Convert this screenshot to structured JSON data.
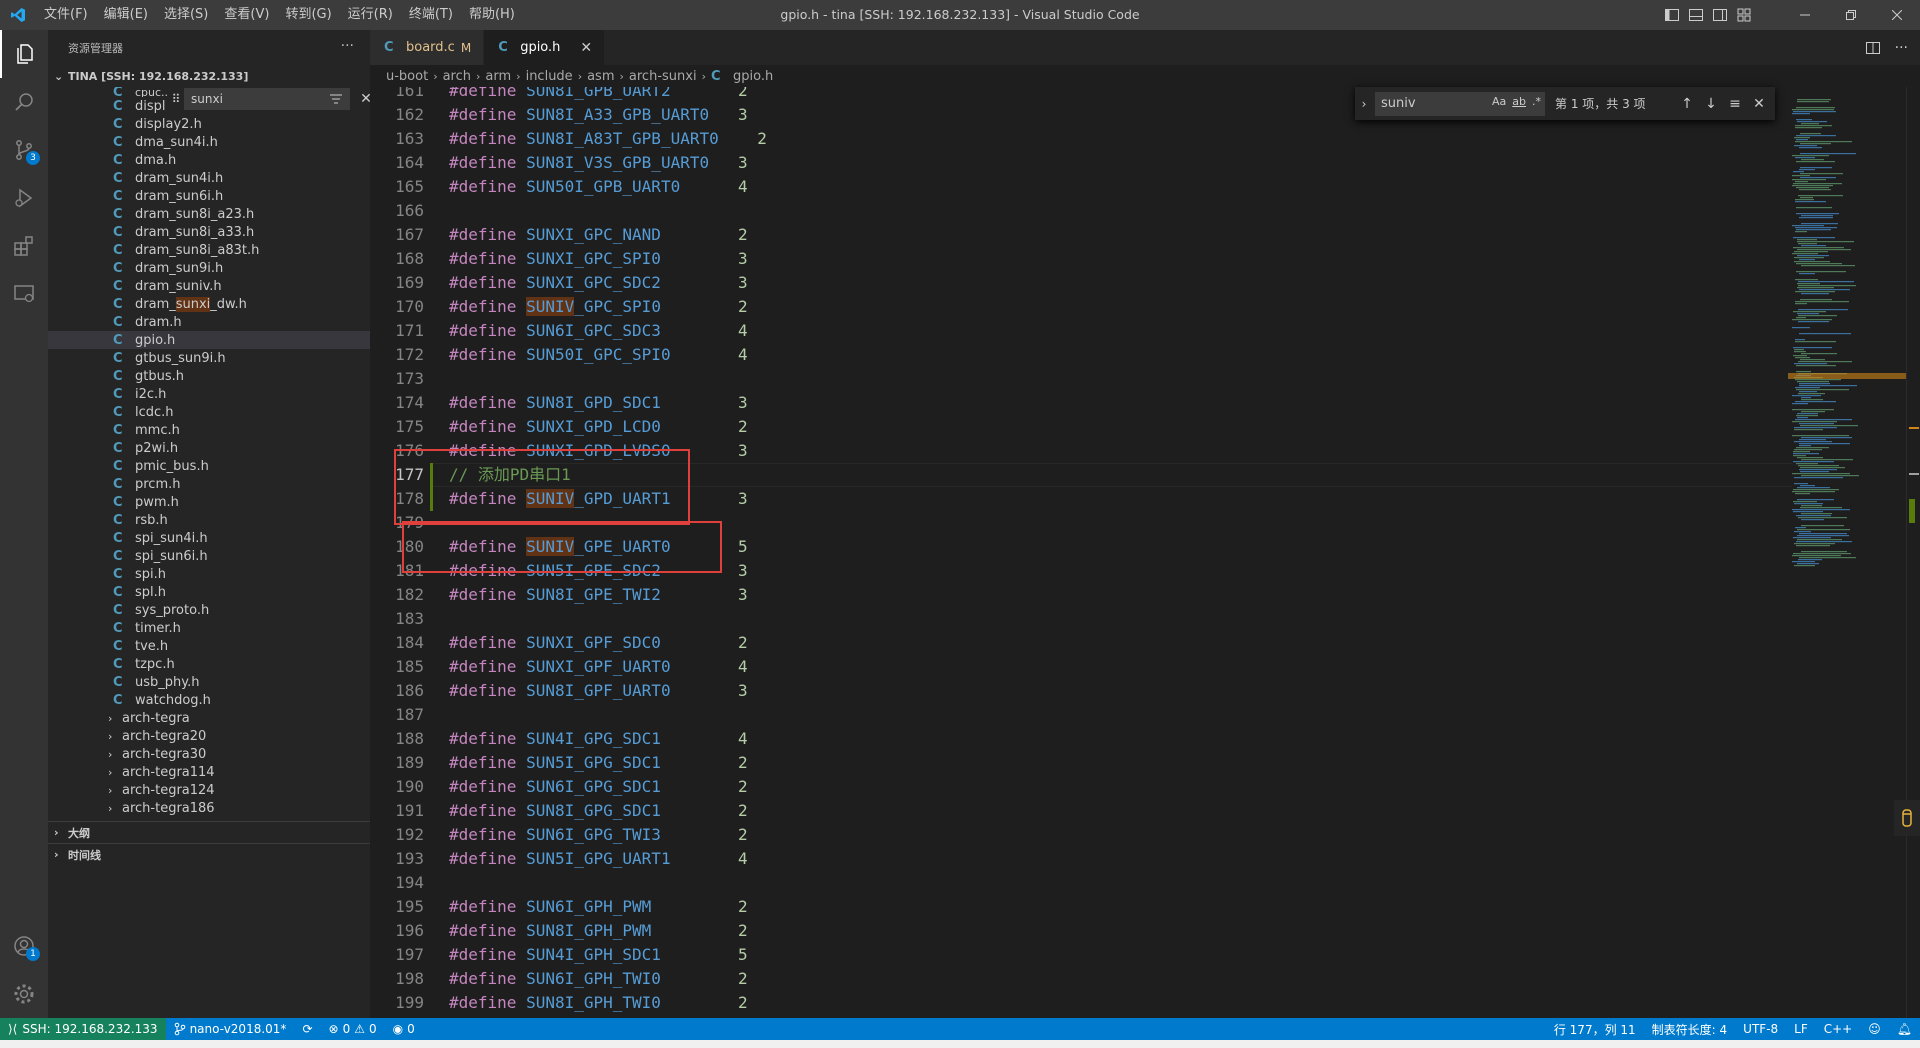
{
  "window": {
    "title": "gpio.h - tina [SSH: 192.168.232.133] - Visual Studio Code",
    "menu": [
      "文件(F)",
      "编辑(E)",
      "选择(S)",
      "查看(V)",
      "转到(G)",
      "运行(R)",
      "终端(T)",
      "帮助(H)"
    ]
  },
  "activity_bar": {
    "source_control_badge": "3",
    "accounts_badge": "1"
  },
  "sidebar": {
    "header": "资源管理器",
    "more": "···",
    "root": "TINA [SSH: 192.168.232.133]",
    "filter_value": "sunxi",
    "partial_top": "cpuc...",
    "files": [
      {
        "pre": "displ",
        "mid": "",
        "post": ""
      },
      {
        "pre": "display2.h",
        "mid": "",
        "post": ""
      },
      {
        "pre": "dma_sun4i.h",
        "mid": "",
        "post": ""
      },
      {
        "pre": "dma.h",
        "mid": "",
        "post": ""
      },
      {
        "pre": "dram_sun4i.h",
        "mid": "",
        "post": ""
      },
      {
        "pre": "dram_sun6i.h",
        "mid": "",
        "post": ""
      },
      {
        "pre": "dram_sun8i_a23.h",
        "mid": "",
        "post": ""
      },
      {
        "pre": "dram_sun8i_a33.h",
        "mid": "",
        "post": ""
      },
      {
        "pre": "dram_sun8i_a83t.h",
        "mid": "",
        "post": ""
      },
      {
        "pre": "dram_sun9i.h",
        "mid": "",
        "post": ""
      },
      {
        "pre": "dram_suniv.h",
        "mid": "",
        "post": ""
      },
      {
        "pre": "dram_",
        "mid": "sunxi",
        "post": "_dw.h"
      },
      {
        "pre": "dram.h",
        "mid": "",
        "post": ""
      },
      {
        "pre": "gpio.h",
        "mid": "",
        "post": ""
      },
      {
        "pre": "gtbus_sun9i.h",
        "mid": "",
        "post": ""
      },
      {
        "pre": "gtbus.h",
        "mid": "",
        "post": ""
      },
      {
        "pre": "i2c.h",
        "mid": "",
        "post": ""
      },
      {
        "pre": "lcdc.h",
        "mid": "",
        "post": ""
      },
      {
        "pre": "mmc.h",
        "mid": "",
        "post": ""
      },
      {
        "pre": "p2wi.h",
        "mid": "",
        "post": ""
      },
      {
        "pre": "pmic_bus.h",
        "mid": "",
        "post": ""
      },
      {
        "pre": "prcm.h",
        "mid": "",
        "post": ""
      },
      {
        "pre": "pwm.h",
        "mid": "",
        "post": ""
      },
      {
        "pre": "rsb.h",
        "mid": "",
        "post": ""
      },
      {
        "pre": "spi_sun4i.h",
        "mid": "",
        "post": ""
      },
      {
        "pre": "spi_sun6i.h",
        "mid": "",
        "post": ""
      },
      {
        "pre": "spi.h",
        "mid": "",
        "post": ""
      },
      {
        "pre": "spl.h",
        "mid": "",
        "post": ""
      },
      {
        "pre": "sys_proto.h",
        "mid": "",
        "post": ""
      },
      {
        "pre": "timer.h",
        "mid": "",
        "post": ""
      },
      {
        "pre": "tve.h",
        "mid": "",
        "post": ""
      },
      {
        "pre": "tzpc.h",
        "mid": "",
        "post": ""
      },
      {
        "pre": "usb_phy.h",
        "mid": "",
        "post": ""
      },
      {
        "pre": "watchdog.h",
        "mid": "",
        "post": ""
      }
    ],
    "folders": [
      "arch-tegra",
      "arch-tegra20",
      "arch-tegra30",
      "arch-tegra114",
      "arch-tegra124",
      "arch-tegra186"
    ],
    "outline": "大纲",
    "timeline": "时间线"
  },
  "tabs": [
    {
      "label": "board.c",
      "modified": "M",
      "active": false
    },
    {
      "label": "gpio.h",
      "modified": "",
      "active": true
    }
  ],
  "breadcrumbs": [
    "u-boot",
    "arch",
    "arm",
    "include",
    "asm",
    "arch-sunxi",
    "gpio.h"
  ],
  "find_widget": {
    "value": "suniv",
    "opt_case": "Aa",
    "opt_word": "ab",
    "opt_regex": ".*",
    "count": "第 1 项，共 3 项"
  },
  "code": [
    {
      "n": "161",
      "kw": "#define",
      "pre": "SUN8I_GPB_UART2",
      "hl": "",
      "post": "",
      "pad": "       ",
      "num": "2"
    },
    {
      "n": "162",
      "kw": "#define",
      "pre": "SUN8I_A33_GPB_UART0",
      "hl": "",
      "post": "",
      "pad": "   ",
      "num": "3"
    },
    {
      "n": "163",
      "kw": "#define",
      "pre": "SUN8I_A83T_GPB_UART0",
      "hl": "",
      "post": "",
      "pad": "    ",
      "num": "2"
    },
    {
      "n": "164",
      "kw": "#define",
      "pre": "SUN8I_V3S_GPB_UART0",
      "hl": "",
      "post": "",
      "pad": "   ",
      "num": "3"
    },
    {
      "n": "165",
      "kw": "#define",
      "pre": "SUN50I_GPB_UART0",
      "hl": "",
      "post": "",
      "pad": "      ",
      "num": "4"
    },
    {
      "n": "166",
      "kw": "",
      "pre": "",
      "hl": "",
      "post": "",
      "pad": "",
      "num": ""
    },
    {
      "n": "167",
      "kw": "#define",
      "pre": "SUNXI_GPC_NAND",
      "hl": "",
      "post": "",
      "pad": "        ",
      "num": "2"
    },
    {
      "n": "168",
      "kw": "#define",
      "pre": "SUNXI_GPC_SPI0",
      "hl": "",
      "post": "",
      "pad": "        ",
      "num": "3"
    },
    {
      "n": "169",
      "kw": "#define",
      "pre": "SUNXI_GPC_SDC2",
      "hl": "",
      "post": "",
      "pad": "        ",
      "num": "3"
    },
    {
      "n": "170",
      "kw": "#define",
      "pre": "",
      "hl": "SUNIV",
      "post": "_GPC_SPI0",
      "pad": "        ",
      "num": "2"
    },
    {
      "n": "171",
      "kw": "#define",
      "pre": "SUN6I_GPC_SDC3",
      "hl": "",
      "post": "",
      "pad": "        ",
      "num": "4"
    },
    {
      "n": "172",
      "kw": "#define",
      "pre": "SUN50I_GPC_SPI0",
      "hl": "",
      "post": "",
      "pad": "       ",
      "num": "4"
    },
    {
      "n": "173",
      "kw": "",
      "pre": "",
      "hl": "",
      "post": "",
      "pad": "",
      "num": ""
    },
    {
      "n": "174",
      "kw": "#define",
      "pre": "SUN8I_GPD_SDC1",
      "hl": "",
      "post": "",
      "pad": "        ",
      "num": "3"
    },
    {
      "n": "175",
      "kw": "#define",
      "pre": "SUNXI_GPD_LCD0",
      "hl": "",
      "post": "",
      "pad": "        ",
      "num": "2"
    },
    {
      "n": "176",
      "kw": "#define",
      "pre": "SUNXI_GPD_LVDS0",
      "hl": "",
      "post": "",
      "pad": "       ",
      "num": "3"
    },
    {
      "n": "177",
      "kw": "",
      "pre": "",
      "hl": "",
      "post": "",
      "pad": "",
      "num": "",
      "comment": "// 添加PD串口1"
    },
    {
      "n": "178",
      "kw": "#define",
      "pre": "",
      "hl": "SUNIV",
      "post": "_GPD_UART1",
      "pad": "       ",
      "num": "3"
    },
    {
      "n": "179",
      "kw": "",
      "pre": "",
      "hl": "",
      "post": "",
      "pad": "",
      "num": ""
    },
    {
      "n": "180",
      "kw": "#define",
      "pre": "",
      "hl": "SUNIV",
      "post": "_GPE_UART0",
      "pad": "       ",
      "num": "5"
    },
    {
      "n": "181",
      "kw": "#define",
      "pre": "SUN5I_GPE_SDC2",
      "hl": "",
      "post": "",
      "pad": "        ",
      "num": "3"
    },
    {
      "n": "182",
      "kw": "#define",
      "pre": "SUN8I_GPE_TWI2",
      "hl": "",
      "post": "",
      "pad": "        ",
      "num": "3"
    },
    {
      "n": "183",
      "kw": "",
      "pre": "",
      "hl": "",
      "post": "",
      "pad": "",
      "num": ""
    },
    {
      "n": "184",
      "kw": "#define",
      "pre": "SUNXI_GPF_SDC0",
      "hl": "",
      "post": "",
      "pad": "        ",
      "num": "2"
    },
    {
      "n": "185",
      "kw": "#define",
      "pre": "SUNXI_GPF_UART0",
      "hl": "",
      "post": "",
      "pad": "       ",
      "num": "4"
    },
    {
      "n": "186",
      "kw": "#define",
      "pre": "SUN8I_GPF_UART0",
      "hl": "",
      "post": "",
      "pad": "       ",
      "num": "3"
    },
    {
      "n": "187",
      "kw": "",
      "pre": "",
      "hl": "",
      "post": "",
      "pad": "",
      "num": ""
    },
    {
      "n": "188",
      "kw": "#define",
      "pre": "SUN4I_GPG_SDC1",
      "hl": "",
      "post": "",
      "pad": "        ",
      "num": "4"
    },
    {
      "n": "189",
      "kw": "#define",
      "pre": "SUN5I_GPG_SDC1",
      "hl": "",
      "post": "",
      "pad": "        ",
      "num": "2"
    },
    {
      "n": "190",
      "kw": "#define",
      "pre": "SUN6I_GPG_SDC1",
      "hl": "",
      "post": "",
      "pad": "        ",
      "num": "2"
    },
    {
      "n": "191",
      "kw": "#define",
      "pre": "SUN8I_GPG_SDC1",
      "hl": "",
      "post": "",
      "pad": "        ",
      "num": "2"
    },
    {
      "n": "192",
      "kw": "#define",
      "pre": "SUN6I_GPG_TWI3",
      "hl": "",
      "post": "",
      "pad": "        ",
      "num": "2"
    },
    {
      "n": "193",
      "kw": "#define",
      "pre": "SUN5I_GPG_UART1",
      "hl": "",
      "post": "",
      "pad": "       ",
      "num": "4"
    },
    {
      "n": "194",
      "kw": "",
      "pre": "",
      "hl": "",
      "post": "",
      "pad": "",
      "num": ""
    },
    {
      "n": "195",
      "kw": "#define",
      "pre": "SUN6I_GPH_PWM",
      "hl": "",
      "post": "",
      "pad": "         ",
      "num": "2"
    },
    {
      "n": "196",
      "kw": "#define",
      "pre": "SUN8I_GPH_PWM",
      "hl": "",
      "post": "",
      "pad": "         ",
      "num": "2"
    },
    {
      "n": "197",
      "kw": "#define",
      "pre": "SUN4I_GPH_SDC1",
      "hl": "",
      "post": "",
      "pad": "        ",
      "num": "5"
    },
    {
      "n": "198",
      "kw": "#define",
      "pre": "SUN6I_GPH_TWI0",
      "hl": "",
      "post": "",
      "pad": "        ",
      "num": "2"
    },
    {
      "n": "199",
      "kw": "#define",
      "pre": "SUN8I_GPH_TWI0",
      "hl": "",
      "post": "",
      "pad": "        ",
      "num": "2"
    }
  ],
  "current_line": "177",
  "status": {
    "remote": "SSH: 192.168.232.133",
    "branch": "nano-v2018.01*",
    "errors": "0",
    "warnings": "0",
    "ports": "0",
    "position": "行 177，列 11",
    "tab_size": "制表符长度: 4",
    "encoding": "UTF-8",
    "eol": "LF",
    "language": "C++"
  },
  "colors": {
    "statusbar": "#007acc",
    "remote": "#16825d",
    "highlight": "#613214",
    "annotation_box": "#e0403c",
    "keyword": "#c586c0",
    "macro": "#569cd6",
    "number": "#b5cea8",
    "comment": "#6a9955"
  }
}
